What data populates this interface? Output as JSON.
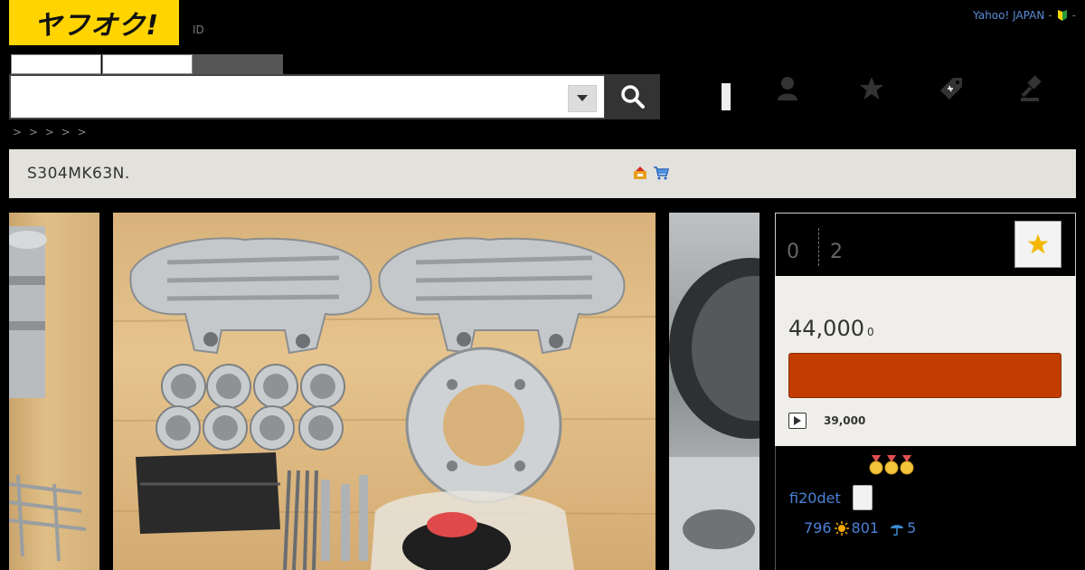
{
  "header": {
    "logo_text": "ヤフオク!",
    "id_label": "ID",
    "portal_link": "Yahoo! JAPAN",
    "separator": "-",
    "separator2": "-"
  },
  "search": {
    "placeholder": "",
    "value": ""
  },
  "breadcrumb": ">    > > > >",
  "item": {
    "title": "S304MK63N."
  },
  "auction": {
    "bid_count": "0",
    "time_left": "2",
    "price": "44,000",
    "price_unit": "0",
    "prev_price": "39,000"
  },
  "seller": {
    "name": "fi20det",
    "rating_good": "796",
    "rating_total": "801",
    "rating_bad": "5"
  },
  "colors": {
    "accent_yellow": "#ffd400",
    "bid_button": "#c13d00",
    "link_blue": "#4a82d6"
  }
}
